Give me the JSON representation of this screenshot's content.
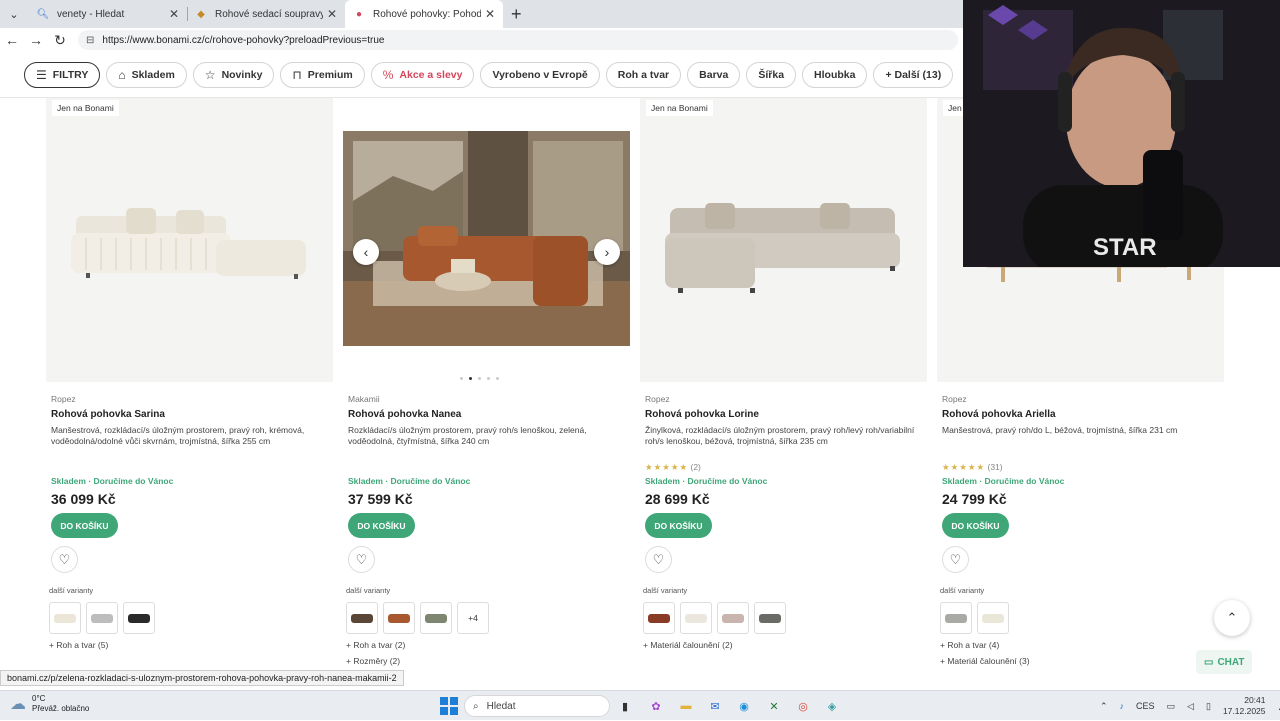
{
  "browser": {
    "tabs": [
      {
        "title": "venety - Hledat",
        "icon": "search-icon",
        "active": false
      },
      {
        "title": "Rohové sedací soupravy - malé, ve",
        "icon": "site-icon",
        "active": false
      },
      {
        "title": "Rohové pohovky: Pohodlné a desi",
        "icon": "bonami-icon",
        "active": true
      }
    ],
    "url": "https://www.bonami.cz/c/rohove-pohovky?preloadPrevious=true"
  },
  "filters": {
    "filtry": "FILTRY",
    "skladem": "Skladem",
    "novinky": "Novinky",
    "premium": "Premium",
    "akce": "Akce a slevy",
    "evropa": "Vyrobeno v Evropě",
    "roh": "Roh a tvar",
    "barva": "Barva",
    "sirka": "Šířka",
    "hloubka": "Hloubka",
    "dalsi": "+ Další (13)"
  },
  "products": [
    {
      "badge": "Jen na Bonami",
      "brand": "Ropez",
      "name": "Rohová pohovka Sarina",
      "desc": "Manšestrová, rozkládací/s úložným prostorem, pravý roh, krémová, voděodolná/odolné vůči skvrnám, trojmístná, šířka 255 cm",
      "rating_stars": "",
      "rating_count": "",
      "stock": "Skladem · Doručíme do Vánoc",
      "price": "36 099 Kč",
      "cart": "DO KOŠÍKU",
      "variants_label": "další varianty",
      "more1": "+ Roh a tvar (5)",
      "more2": ""
    },
    {
      "badge": "",
      "brand": "Makamii",
      "name": "Rohová pohovka Nanea",
      "desc": "Rozkládací/s úložným prostorem, pravý roh/s lenoškou, zelená, voděodolná, čtyřmístná, šířka 240 cm",
      "rating_stars": "",
      "rating_count": "",
      "stock": "Skladem · Doručíme do Vánoc",
      "price": "37 599 Kč",
      "cart": "DO KOŠÍKU",
      "variants_label": "další varianty",
      "swatch_more": "+4",
      "more1": "+ Roh a tvar (2)",
      "more2": "+ Rozměry (2)"
    },
    {
      "badge": "Jen na Bonami",
      "brand": "Ropez",
      "name": "Rohová pohovka Lorine",
      "desc": "Žinylková, rozkládací/s úložným prostorem, pravý roh/levý roh/variabilní roh/s lenoškou, béžová, trojmístná, šířka 235 cm",
      "rating_stars": "★★★★★",
      "rating_count": "(2)",
      "stock": "Skladem · Doručíme do Vánoc",
      "price": "28 699 Kč",
      "cart": "DO KOŠÍKU",
      "variants_label": "další varianty",
      "more1": "+ Materiál čalounění (2)",
      "more2": ""
    },
    {
      "badge": "Jen na Bonami",
      "brand": "Ropez",
      "name": "Rohová pohovka Ariella",
      "desc": "Manšestrová, pravý roh/do L, béžová, trojmístná, šířka 231 cm",
      "rating_stars": "★★★★★",
      "rating_count": "(31)",
      "stock": "Skladem · Doručíme do Vánoc",
      "price": "24 799 Kč",
      "cart": "DO KOŠÍKU",
      "variants_label": "další varianty",
      "more1": "+ Roh a tvar (4)",
      "more2": "+ Materiál čalounění (3)"
    }
  ],
  "chat": "CHAT",
  "status_url": "bonami.cz/p/zelena-rozkladaci-s-uloznym-prostorem-rohova-pohovka-pravy-roh-nanea-makamii-2",
  "taskbar": {
    "temp": "0°C",
    "weather": "Převáž. oblačno",
    "search": "Hledat",
    "lang": "CES",
    "time": "20:41",
    "date": "17.12.2025"
  },
  "colors": {
    "accent_green": "#3fa678",
    "sale_red": "#d5455b",
    "star": "#d9b34a"
  }
}
